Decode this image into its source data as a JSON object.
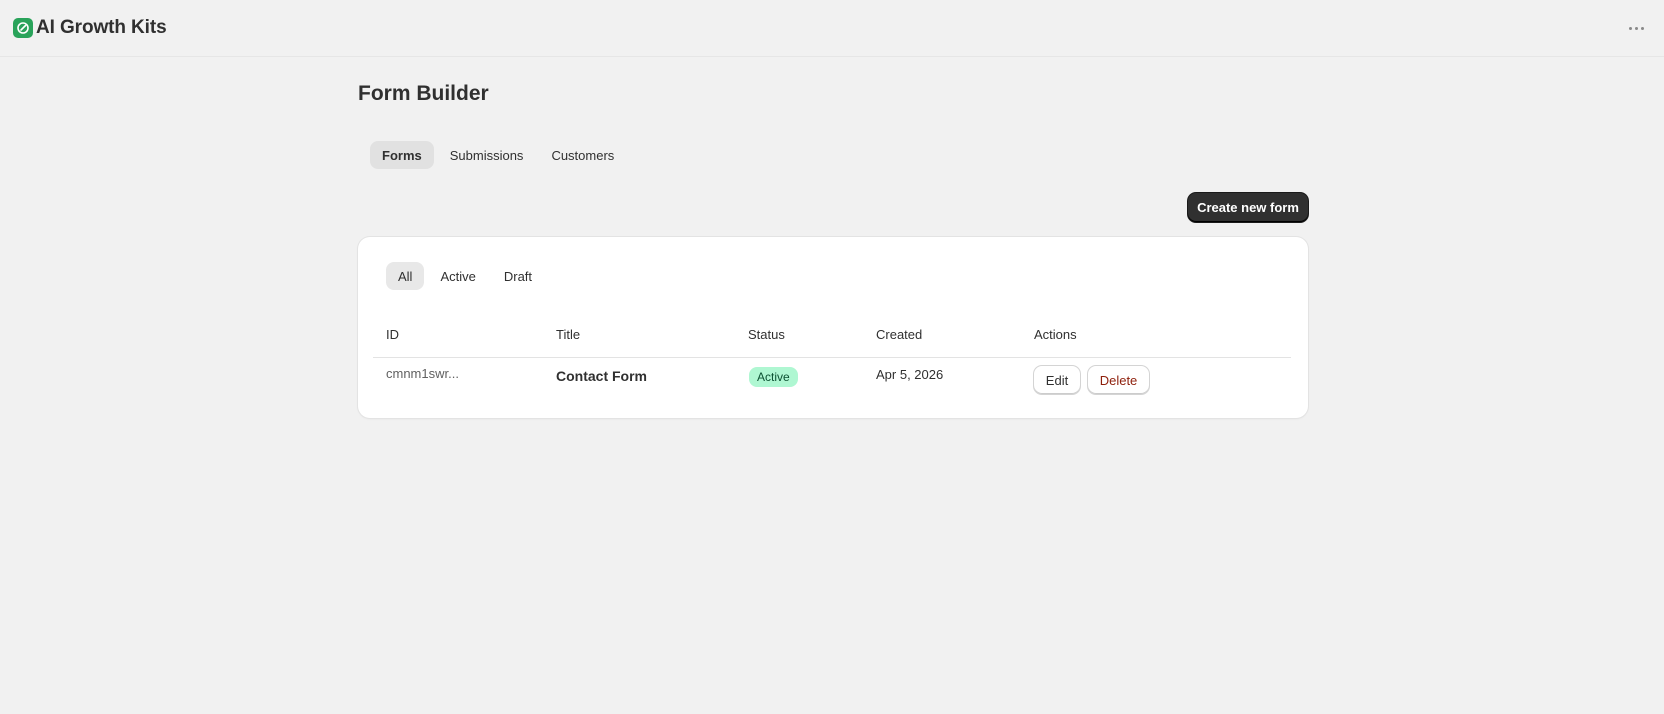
{
  "app": {
    "title": "AI Growth Kits"
  },
  "page": {
    "title": "Form Builder"
  },
  "tabs": [
    {
      "label": "Forms",
      "active": true
    },
    {
      "label": "Submissions",
      "active": false
    },
    {
      "label": "Customers",
      "active": false
    }
  ],
  "toolbar": {
    "create_label": "Create new form"
  },
  "filters": [
    {
      "label": "All",
      "active": true
    },
    {
      "label": "Active",
      "active": false
    },
    {
      "label": "Draft",
      "active": false
    }
  ],
  "table": {
    "headers": {
      "id": "ID",
      "title": "Title",
      "status": "Status",
      "created": "Created",
      "actions": "Actions"
    },
    "rows": [
      {
        "id": "cmnm1swr...",
        "title": "Contact Form",
        "status": "Active",
        "created": "Apr 5, 2026",
        "edit_label": "Edit",
        "delete_label": "Delete"
      }
    ]
  },
  "colors": {
    "brand": "#29a35a",
    "primary_button": "#303030",
    "status_active_bg": "#aff7d2",
    "status_active_text": "#0c5132",
    "delete_text": "#8e1f0b"
  },
  "icons": {
    "logo": "app-logo-icon",
    "more": "more-horizontal-icon"
  }
}
